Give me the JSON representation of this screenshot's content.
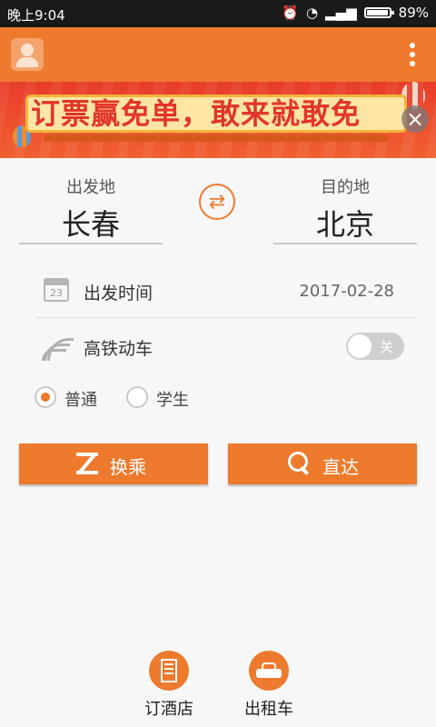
{
  "status_bar": {
    "time": "晚上9:04",
    "battery": "89%",
    "battery_level": 0.89
  },
  "app_bar": {
    "avatar_icon": "user-avatar-icon",
    "menu_icon": "more-vertical-icon",
    "color": "#ee7a2d"
  },
  "banner": {
    "text": "订票赢免单，敢来就敢免",
    "close": "×"
  },
  "route": {
    "from_label": "出发地",
    "from_value": "长春",
    "to_label": "目的地",
    "to_value": "北京",
    "swap_icon": "⇄"
  },
  "date": {
    "label": "出发时间",
    "value": "2017-02-28",
    "icon_day": "23"
  },
  "high_speed": {
    "label": "高铁动车",
    "toggle_text": "关",
    "on": false
  },
  "ticket_type": {
    "options": [
      "普通",
      "学生"
    ],
    "selected": "普通"
  },
  "buttons": {
    "transfer": "换乘",
    "direct": "直达"
  },
  "bottom_nav": {
    "hotel": "订酒店",
    "taxi": "出租车"
  }
}
